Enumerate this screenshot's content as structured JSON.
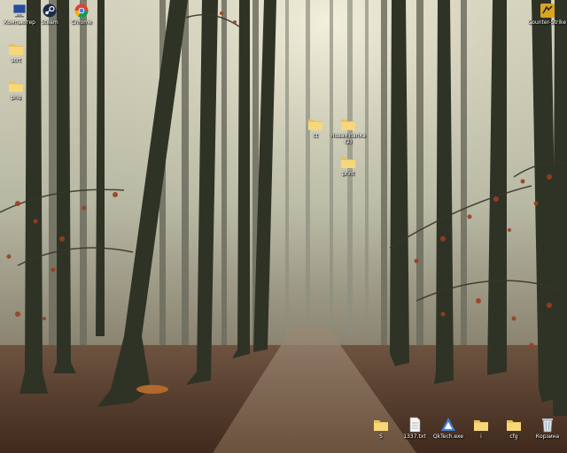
{
  "desktop": {
    "wallpaper": "misty autumn forest with path",
    "top_icons": [
      {
        "label": "Компьютер",
        "icon": "computer-icon"
      },
      {
        "label": "Steam",
        "icon": "steam-icon"
      },
      {
        "label": "Chrome",
        "icon": "chrome-icon"
      }
    ],
    "top_right_icon": {
      "label": "Counter-Strike Global Offe...",
      "icon": "game-icon"
    },
    "left_icons": [
      {
        "label": "scrt",
        "icon": "folder-icon"
      },
      {
        "label": "png",
        "icon": "folder-icon"
      }
    ],
    "center_icons": [
      {
        "label": "ct",
        "icon": "folder-icon"
      },
      {
        "label": "Новая папка (2)",
        "icon": "folder-icon"
      },
      {
        "label": "print",
        "icon": "folder-icon"
      }
    ],
    "bottom_icons": [
      {
        "label": "S",
        "icon": "folder-icon"
      },
      {
        "label": "1337.txt",
        "icon": "text-file-icon"
      },
      {
        "label": "QkTech.exe",
        "icon": "app-icon"
      },
      {
        "label": "i",
        "icon": "folder-icon"
      },
      {
        "label": "cfg",
        "icon": "folder-icon"
      },
      {
        "label": "Корзина",
        "icon": "recycle-bin-icon"
      }
    ]
  }
}
